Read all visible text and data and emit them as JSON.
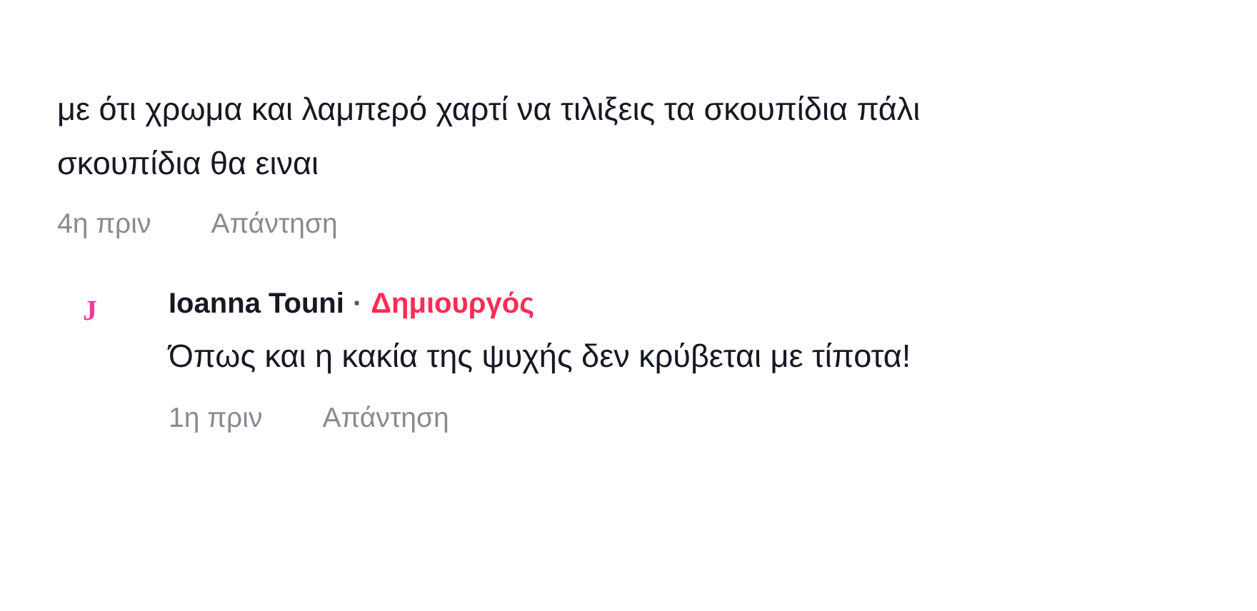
{
  "comment": {
    "text": "με ότι χρωμα και λαμπερό χαρτί να τιλιξεις τα σκουπίδια πάλι σκουπίδια θα ειναι",
    "time": "4η πριν",
    "reply_link": "Απάντηση"
  },
  "reply": {
    "avatar_letter": "J",
    "author": "Ioanna Touni",
    "separator": "·",
    "badge": "Δημιουργός",
    "text": "Όπως και η κακία της ψυχής δεν κρύβεται με τίποτα!",
    "time": "1η πριν",
    "reply_link": "Απάντηση"
  }
}
